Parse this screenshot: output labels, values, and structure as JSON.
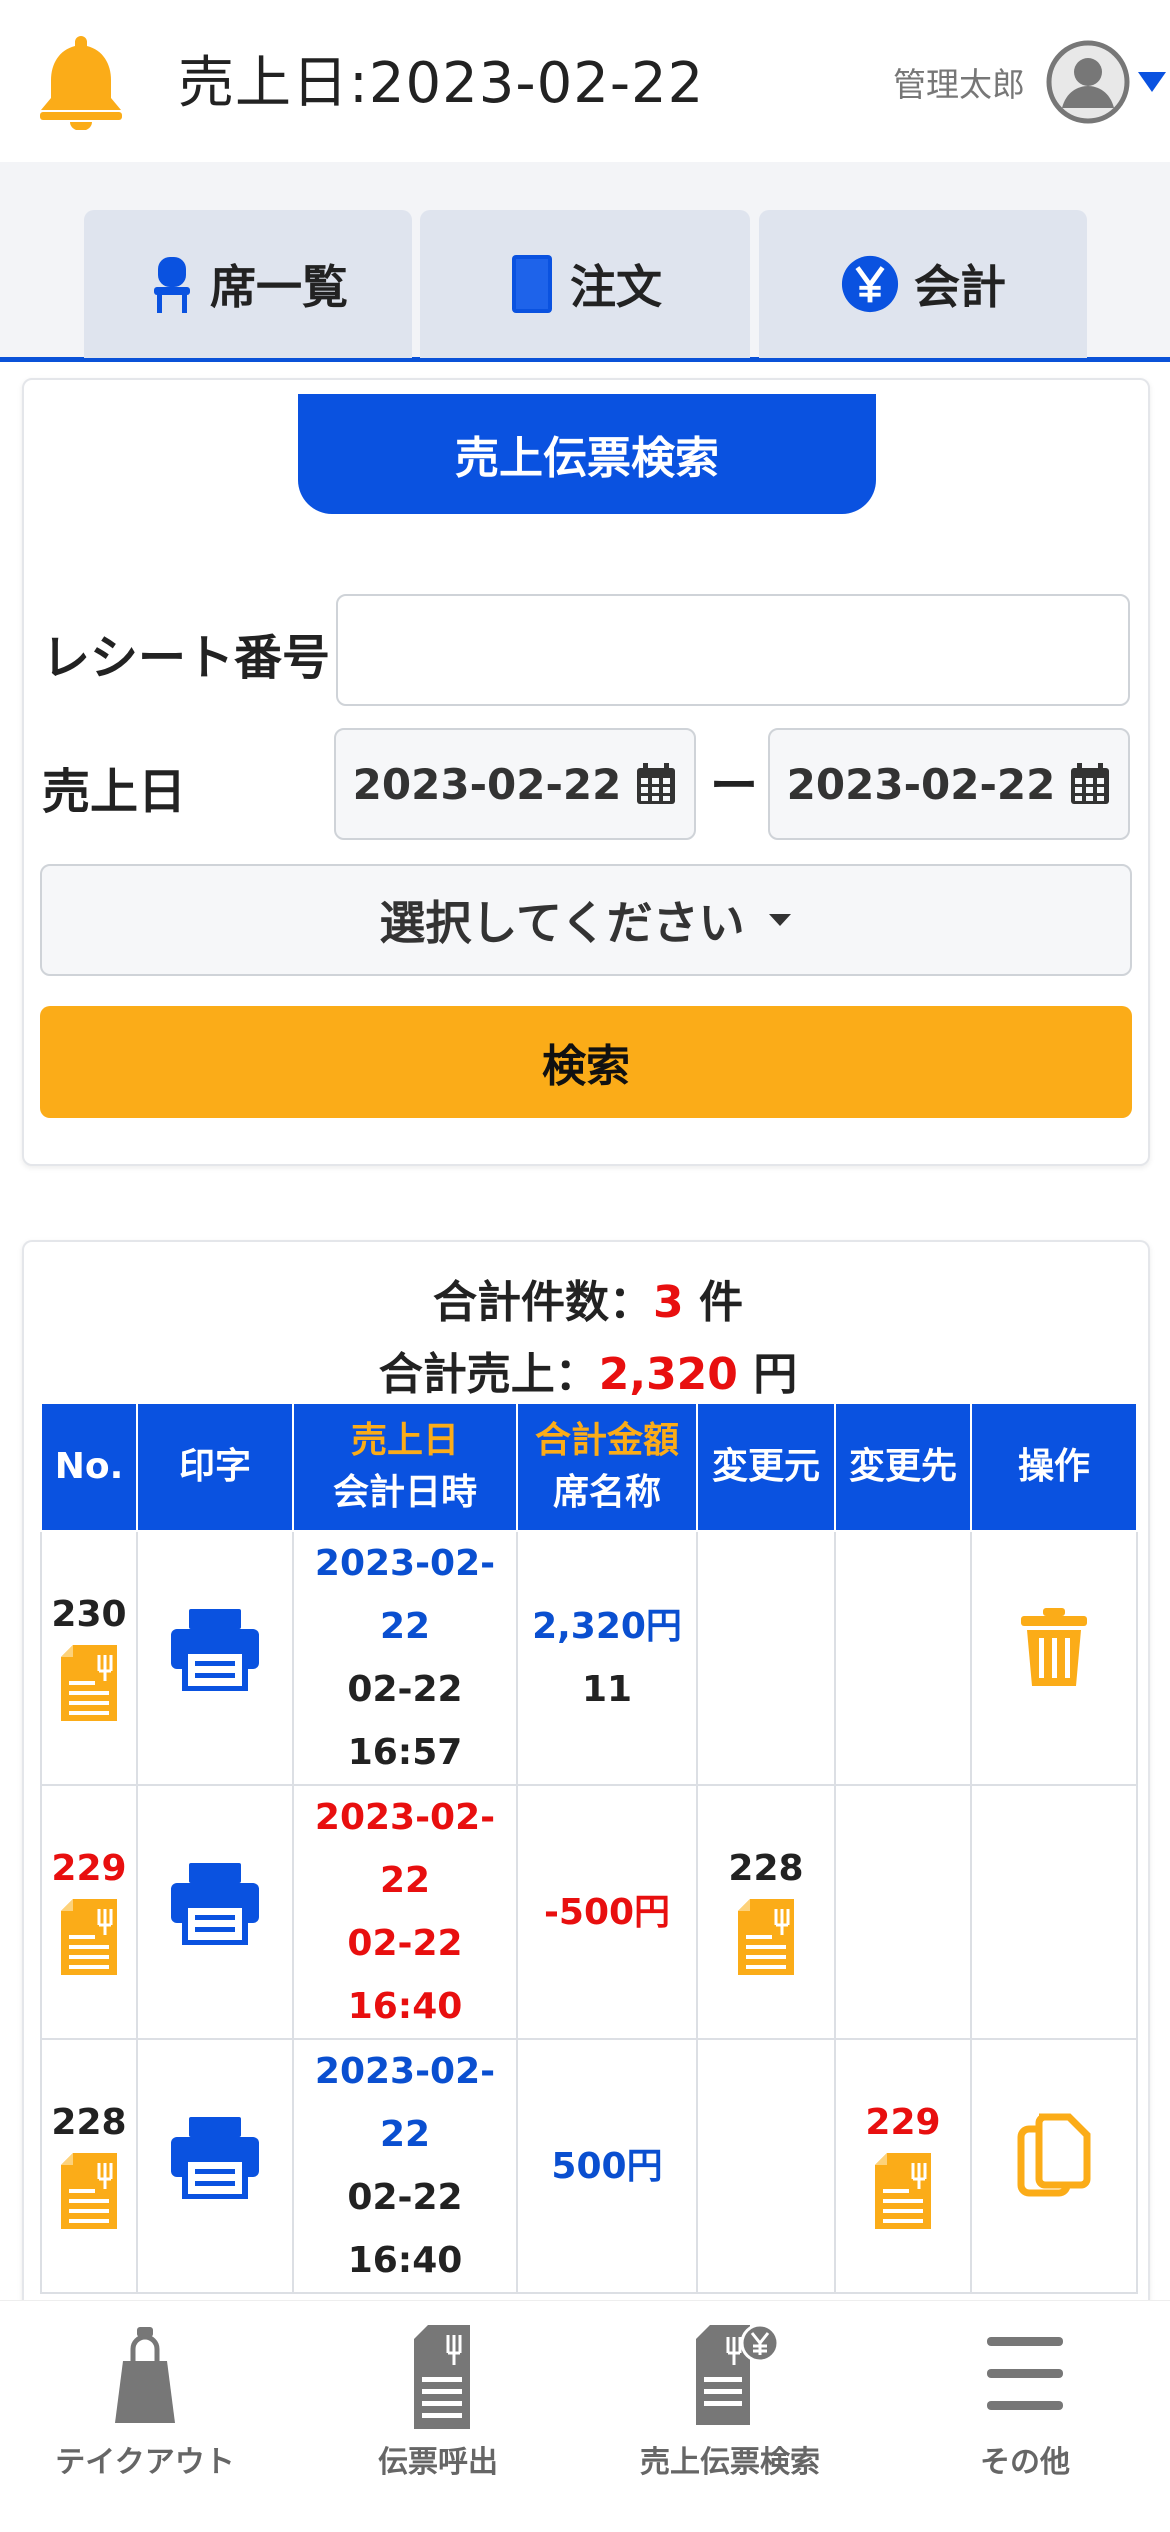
{
  "header": {
    "title": "売上日:2023-02-22",
    "user_name": "管理太郎"
  },
  "tabs": [
    {
      "label": "席一覧",
      "icon": "chair-icon"
    },
    {
      "label": "注文",
      "icon": "book-icon"
    },
    {
      "label": "会計",
      "icon": "yen-icon"
    }
  ],
  "search": {
    "heading": "売上伝票検索",
    "receipt_label": "レシート番号",
    "receipt_value": "",
    "date_label": "売上日",
    "date_from": "2023-02-22",
    "date_to": "2023-02-22",
    "date_separator": "ー",
    "select_placeholder": "選択してください",
    "search_button": "検索"
  },
  "summary": {
    "count_label": "合計件数：",
    "count_value": "3",
    "count_unit": "件",
    "sales_label": "合計売上：",
    "sales_value": "2,320",
    "sales_unit": "円"
  },
  "table": {
    "headers": {
      "no": "No.",
      "print": "印字",
      "sales_date": "売上日",
      "checkout_time": "会計日時",
      "total_amount": "合計金額",
      "seat_name": "席名称",
      "changed_from": "変更元",
      "changed_to": "変更先",
      "actions": "操作"
    },
    "rows": [
      {
        "no": "230",
        "sales_date": "2023-02-22",
        "checkout_time": "02-22 16:57",
        "amount": "2,320円",
        "seat": "11",
        "changed_from": "",
        "changed_to": "",
        "action": "delete"
      },
      {
        "no": "229",
        "sales_date": "2023-02-22",
        "checkout_time": "02-22 16:40",
        "amount": "-500円",
        "seat": "",
        "changed_from": "228",
        "changed_to": "",
        "action": ""
      },
      {
        "no": "228",
        "sales_date": "2023-02-22",
        "checkout_time": "02-22 16:40",
        "amount": "500円",
        "seat": "",
        "changed_from": "",
        "changed_to": "229",
        "action": "copy"
      }
    ]
  },
  "bottom_nav": [
    {
      "label": "テイクアウト",
      "icon": "takeout-bag-icon"
    },
    {
      "label": "伝票呼出",
      "icon": "slip-icon"
    },
    {
      "label": "売上伝票検索",
      "icon": "sales-slip-yen-icon"
    },
    {
      "label": "その他",
      "icon": "menu-icon"
    }
  ],
  "colors": {
    "primary_blue": "#0a52e0",
    "accent_orange": "#fbac18",
    "negative_red": "#e80f0f"
  }
}
